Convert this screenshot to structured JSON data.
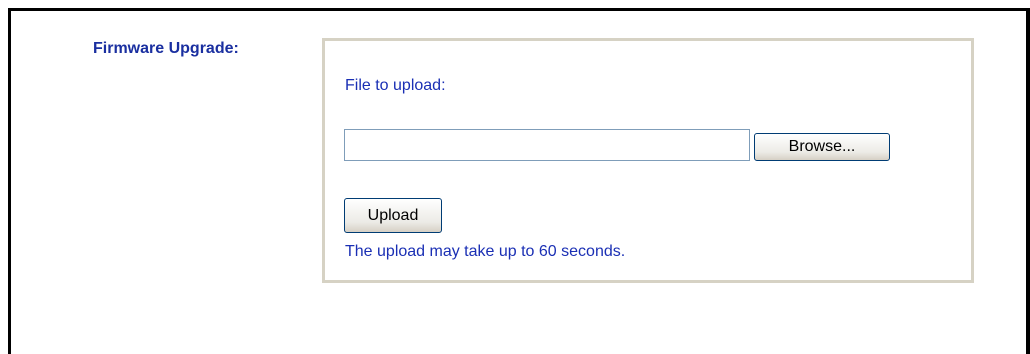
{
  "firmware": {
    "section_label": "Firmware Upgrade:",
    "file_label": "File to upload:",
    "file_value": "",
    "browse_label": "Browse...",
    "upload_label": "Upload",
    "note": "The upload may take up to 60 seconds."
  },
  "colors": {
    "label_blue": "#1a2fa0",
    "text_blue": "#1a2fb4",
    "panel_border": "#d6d2c4",
    "frame_border": "#000000"
  }
}
